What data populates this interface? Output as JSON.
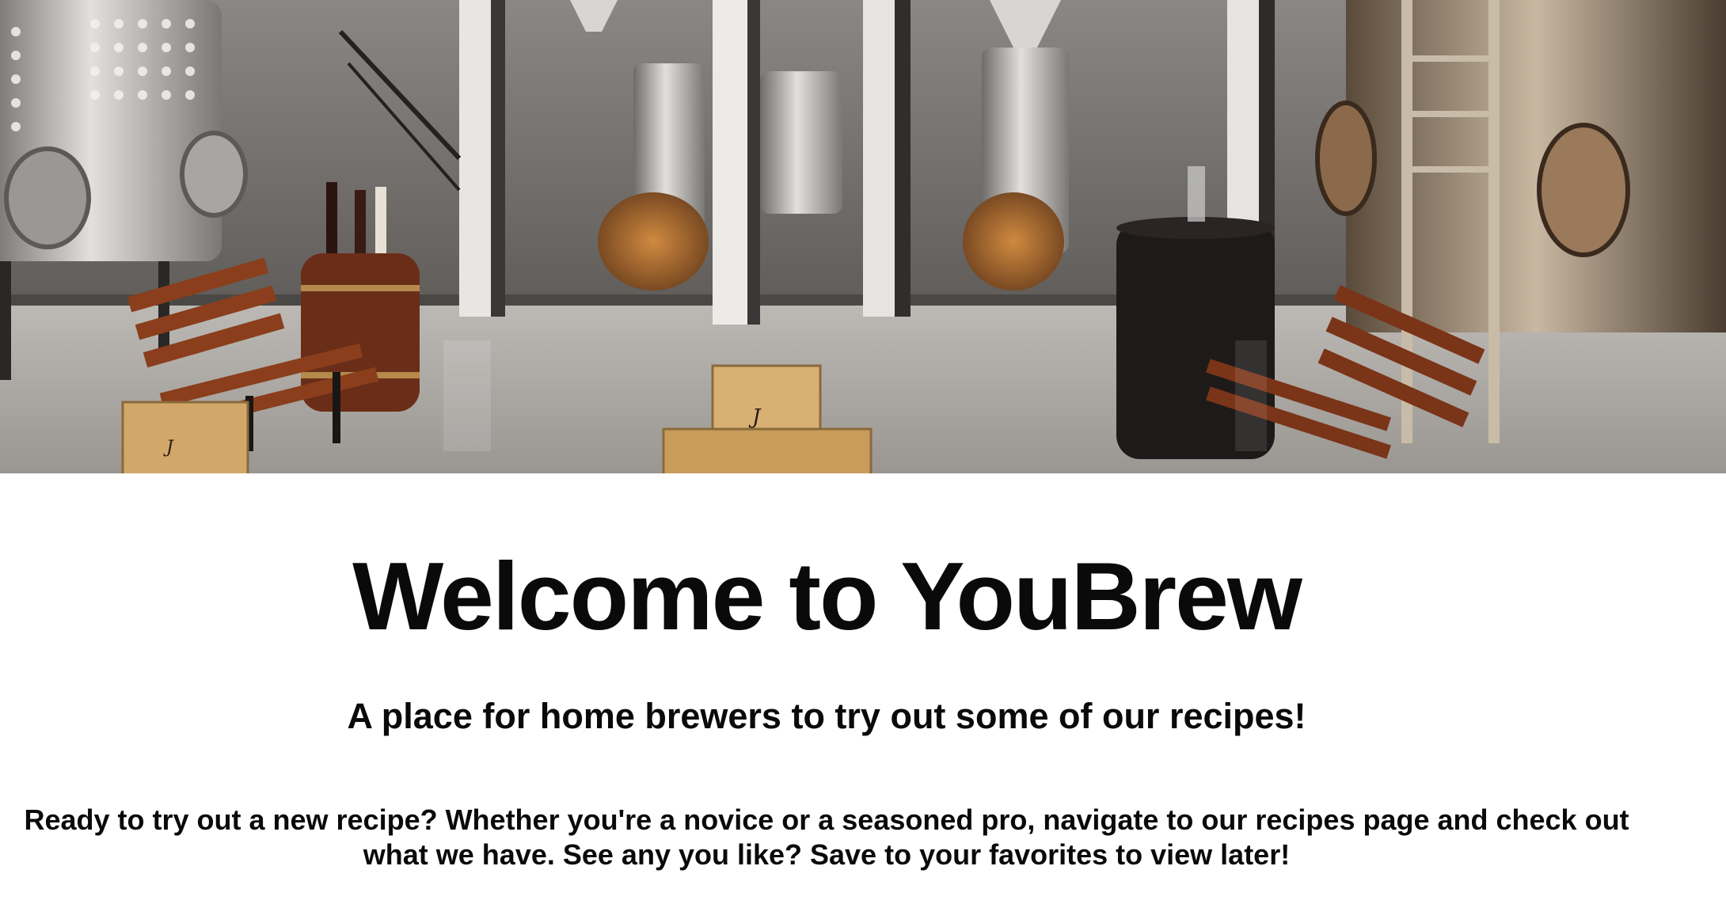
{
  "hero": {
    "image_name": "brewery-interior-photo"
  },
  "welcome": {
    "title": "Welcome to YouBrew",
    "subtitle": "A place for home brewers to try out some of our recipes!",
    "intro": "Ready to try out a new recipe? Whether you're a novice or a seasoned pro, navigate to our recipes page and check out what we have. See any you like? Save to your favorites to view later!"
  },
  "colors": {
    "background": "#ffffff",
    "text": "#0a0a0a",
    "wood": "#8a4a2a",
    "crate": "#d2a86a",
    "steel": "#b8b6b2"
  }
}
